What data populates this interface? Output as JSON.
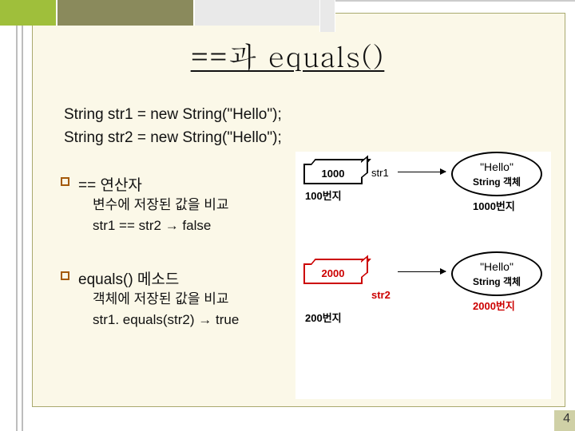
{
  "title": "==과 equals()",
  "code": {
    "line1": "String str1 = new String(\"Hello\");",
    "line2": "String str2 = new String(\"Hello\");"
  },
  "sections": [
    {
      "head": "== 연산자",
      "sub1": "변수에 저장된 값을 비교",
      "sub2": "str1 == str2 → false"
    },
    {
      "head": "equals() 메소드",
      "sub1": "객체에 저장된 값을 비교",
      "sub2": "str1. equals(str2) → true"
    }
  ],
  "diagram": {
    "box1_value": "1000",
    "box1_label": "str1",
    "addr1_label": "100번지",
    "obj_hello": "\"Hello\"",
    "obj_label": "String 객체",
    "obj_addr1": "1000번지",
    "box2_value": "2000",
    "box2_label": "str2",
    "addr2_label": "200번지",
    "obj_addr2": "2000번지"
  },
  "page_number": "4"
}
